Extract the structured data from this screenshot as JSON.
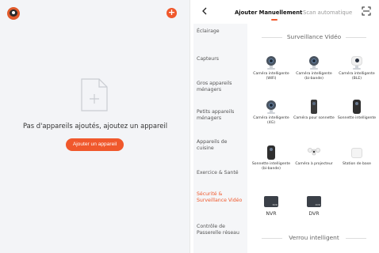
{
  "left": {
    "empty_text": "Pas d'appareils ajoutés, ajoutez un appareil",
    "add_device_button": "Ajouter un appareil",
    "add_icon": "+"
  },
  "right": {
    "tabs": {
      "manual": "Ajouter Manuellement",
      "scan": "Scan automatique"
    },
    "categories": [
      "Éclairage",
      "Capteurs",
      "Gros appareils ménagers",
      "Petits appareils ménagers",
      "Appareils de cuisine",
      "Exercice & Santé",
      "Sécurité & Surveillance Vidéo",
      "Contrôle de Passerelle réseau"
    ],
    "active_category": "Sécurité & Surveillance Vidéo",
    "section_title": "Surveillance Vidéo",
    "devices": [
      "Caméra intelligente (WiFi)",
      "Caméra intelligente (bi-bande)",
      "Caméra intelligente (BLE)",
      "Caméra intelligente (4G)",
      "Caméra pour sonnette",
      "Sonnette intelligente",
      "Sonnette intelligente (bi-bande)",
      "Caméra à projecteur",
      "Station de base",
      "NVR",
      "DVR"
    ],
    "nvr_tag": "NVR",
    "dvr_tag": "DVR",
    "next_section_title": "Verrou intelligent"
  },
  "colors": {
    "accent": "#f0582c",
    "sidebar_bg": "#f5f6f8",
    "left_bg": "#f3f4f7"
  }
}
